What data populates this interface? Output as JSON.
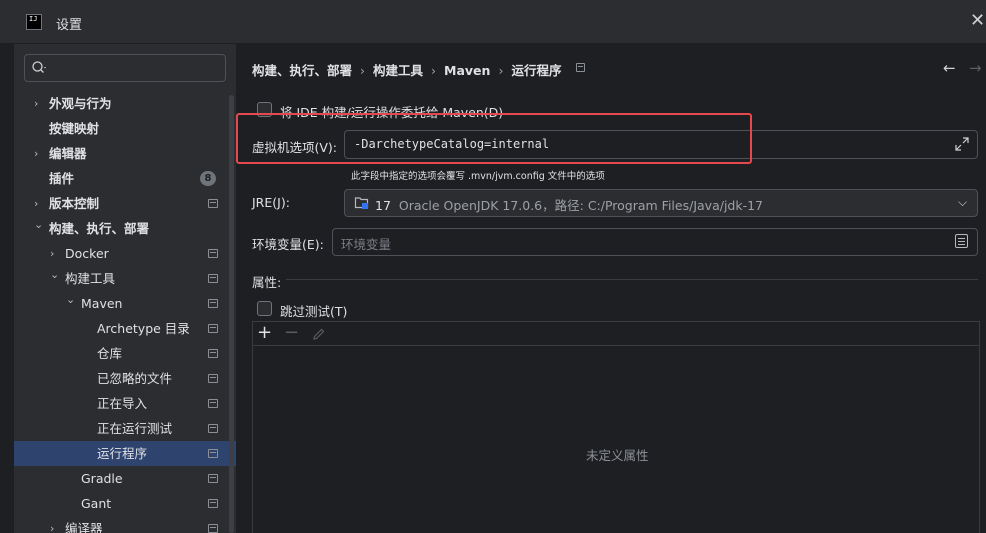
{
  "window": {
    "title": "设置",
    "close_glyph": "✕",
    "app_icon_text": "IJ"
  },
  "search": {
    "icon": "search-icon"
  },
  "sidebar": {
    "items": [
      {
        "label": "外观与行为",
        "expandable": true,
        "expanded": false,
        "bold": true,
        "pinned": false
      },
      {
        "label": "按键映射",
        "expandable": false,
        "bold": true,
        "pinned": false
      },
      {
        "label": "编辑器",
        "expandable": true,
        "expanded": false,
        "bold": true,
        "pinned": false
      },
      {
        "label": "插件",
        "expandable": false,
        "bold": true,
        "badge": "8",
        "pinned": false
      },
      {
        "label": "版本控制",
        "expandable": true,
        "expanded": false,
        "bold": true,
        "pinned": true
      },
      {
        "label": "构建、执行、部署",
        "expandable": true,
        "expanded": true,
        "bold": true,
        "pinned": false
      },
      {
        "label": "Docker",
        "expandable": true,
        "expanded": false,
        "pinned": true
      },
      {
        "label": "构建工具",
        "expandable": true,
        "expanded": true,
        "pinned": true
      },
      {
        "label": "Maven",
        "expandable": true,
        "expanded": true,
        "pinned": true
      },
      {
        "label": "Archetype 目录",
        "pinned": true
      },
      {
        "label": "仓库",
        "pinned": true
      },
      {
        "label": "已忽略的文件",
        "pinned": true
      },
      {
        "label": "正在导入",
        "pinned": true
      },
      {
        "label": "正在运行测试",
        "pinned": true
      },
      {
        "label": "运行程序",
        "pinned": true,
        "selected": true
      },
      {
        "label": "Gradle",
        "pinned": true
      },
      {
        "label": "Gant",
        "pinned": true
      },
      {
        "label": "编译器",
        "expandable": true,
        "expanded": false,
        "pinned": true
      }
    ]
  },
  "breadcrumb": {
    "parts": [
      "构建、执行、部署",
      "构建工具",
      "Maven",
      "运行程序"
    ],
    "separator": "›"
  },
  "nav": {
    "back_glyph": "←",
    "forward_glyph": "→"
  },
  "delegate_checkbox": {
    "label": "将 IDE 构建/运行操作委托给 Maven(D)",
    "checked": false
  },
  "vm_options": {
    "label": "虚拟机选项(V):",
    "value": "-DarchetypeCatalog=internal",
    "hint": "此字段中指定的选项会覆写 .mvn/jvm.config 文件中的选项",
    "highlight_color": "#e5484d"
  },
  "jre": {
    "label": "JRE(J):",
    "version": "17",
    "description": "Oracle OpenJDK 17.0.6，路径: C:/Program Files/Java/jdk-17"
  },
  "env": {
    "label": "环境变量(E):",
    "placeholder": "环境变量"
  },
  "properties": {
    "label": "属性:",
    "skip_tests_label": "跳过测试(T)",
    "skip_tests_checked": false,
    "add_glyph": "+",
    "remove_glyph": "−",
    "empty_text": "未定义属性"
  },
  "colors": {
    "background": "#1e1f22",
    "panel": "#2b2d30",
    "selection": "#2e436e",
    "text": "#dfe1e5"
  }
}
